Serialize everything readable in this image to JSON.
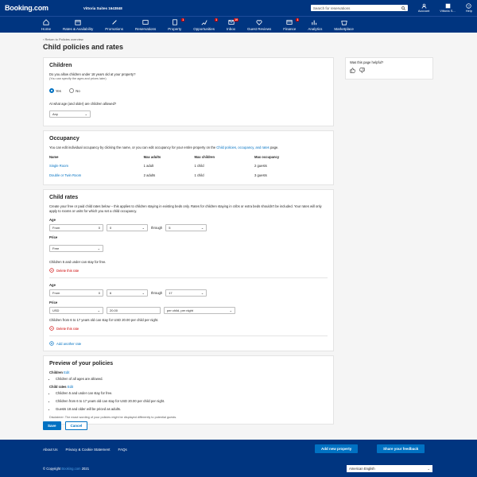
{
  "header": {
    "logo": "Booking.com",
    "property": "Vittoria Suites 1643848",
    "search_placeholder": "Search for reservations",
    "account_label": "Account",
    "user_label": "Vittoria S...",
    "help_label": "Help"
  },
  "nav": [
    {
      "label": "Home",
      "icon": "home-icon"
    },
    {
      "label": "Rates & Availability",
      "icon": "calendar-icon"
    },
    {
      "label": "Promotions",
      "icon": "promotions-icon"
    },
    {
      "label": "Reservations",
      "icon": "reservations-icon"
    },
    {
      "label": "Property",
      "icon": "property-icon",
      "badge": "1"
    },
    {
      "label": "Opportunities",
      "icon": "opportunities-icon",
      "badge": "1"
    },
    {
      "label": "Inbox",
      "icon": "inbox-icon",
      "badge": "10"
    },
    {
      "label": "Guest Reviews",
      "icon": "reviews-icon"
    },
    {
      "label": "Finance",
      "icon": "finance-icon",
      "badge": "1"
    },
    {
      "label": "Analytics",
      "icon": "analytics-icon"
    },
    {
      "label": "Marketplace",
      "icon": "marketplace-icon"
    }
  ],
  "breadcrumb": "Return to Policies overview",
  "title": "Child policies and rates",
  "children": {
    "heading": "Children",
    "question": "Do you allow children under 18 years old at your property?",
    "hint": "(You can specify the ages and prices later)",
    "yes": "Yes",
    "no": "No",
    "age_question": "At what age (and older) are children allowed?",
    "age_value": "Any"
  },
  "occupancy": {
    "heading": "Occupancy",
    "text_pre": "You can edit individual occupancy by clicking the name, or you can edit occupancy for your entire property on the ",
    "text_link": "Child policies, occupancy, and rates",
    "text_post": " page.",
    "columns": [
      "Name",
      "Max adults",
      "Max children",
      "Max occupancy"
    ],
    "rows": [
      [
        "Single Room",
        "1 adult",
        "1 child",
        "2 guests"
      ],
      [
        "Double or Twin Room",
        "2 adults",
        "1 child",
        "3 guests"
      ]
    ]
  },
  "rates": {
    "heading": "Child rates",
    "intro": "Create your free or paid child rates below – this applies to children staying in existing beds only. Rates for children staying in cribs or extra beds shouldn't be included. Your rates will only apply to rooms or units for which you set a child occupancy.",
    "age_label": "Age",
    "price_label": "Price",
    "from": "From",
    "through": "through",
    "r1": {
      "from": "0",
      "to": "5",
      "price": "Free",
      "summary": "Children 5 and under can stay for free."
    },
    "r2": {
      "from": "6",
      "to": "17",
      "currency": "USD",
      "amount": "20.00",
      "unit": "per child, per night",
      "summary": "Children from 6 to 17 years old can stay for USD 20.00 per child per night."
    },
    "delete": "Delete this rate",
    "add": "Add another rate"
  },
  "preview": {
    "heading": "Preview of your policies",
    "children_label": "Children",
    "edit": "Edit",
    "children_item": "Children of all ages are allowed.",
    "rates_label": "Child rates",
    "items": [
      "Children 5 and under can stay for free.",
      "Children from 6 to 17 years old can stay for USD 20.00 per child per night.",
      "Guests 18 and older will be priced as adults."
    ],
    "disclaimer": "Disclaimer: The exact wording of your policies might be displayed differently to potential guests."
  },
  "helpful": {
    "question": "Was this page helpful?"
  },
  "actions": {
    "save": "Save",
    "cancel": "Cancel"
  },
  "footer": {
    "about": "About Us",
    "privacy": "Privacy & Cookie Statement",
    "faqs": "FAQs",
    "add_property": "Add new property",
    "feedback": "Share your feedback",
    "copyright_pre": "© Copyright ",
    "copyright_brand": "Booking.com",
    "copyright_year": " 2021",
    "language": "American English"
  },
  "colors": {
    "brand": "#003580",
    "accent": "#0071c2",
    "danger": "#cc0000"
  }
}
